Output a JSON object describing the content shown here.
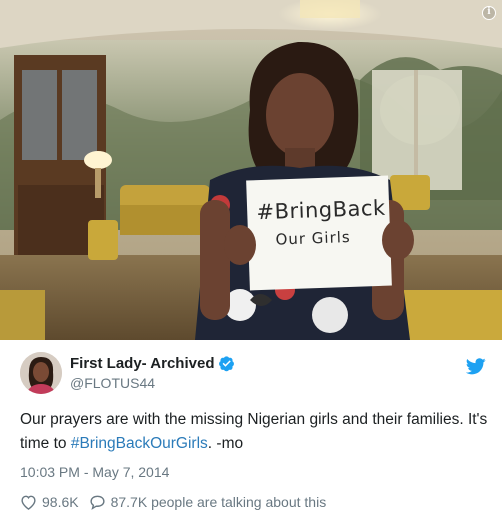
{
  "photo": {
    "alt_icon": "info-icon",
    "sign": {
      "line1": "#BringBack",
      "line2": "Our Girls"
    }
  },
  "author": {
    "display_name": "First Lady- Archived",
    "handle": "@FLOTUS44",
    "verified_icon": "verified-badge-icon",
    "avatar": "avatar-image"
  },
  "brand": {
    "icon": "twitter-bird-icon",
    "color": "#1da1f2"
  },
  "tweet": {
    "text_before": "Our prayers are with the missing Nigerian girls and their families. It's time to ",
    "hashtag": "#BringBackOurGirls",
    "text_after": ". -mo",
    "timestamp": "10:03 PM - May 7, 2014"
  },
  "actions": {
    "likes_icon": "heart-icon",
    "likes": "98.6K",
    "replies_icon": "comment-icon",
    "talking": "87.7K people are talking about this"
  },
  "colors": {
    "link": "#2b7bb9",
    "meta": "#697882",
    "text": "#1c2022"
  }
}
